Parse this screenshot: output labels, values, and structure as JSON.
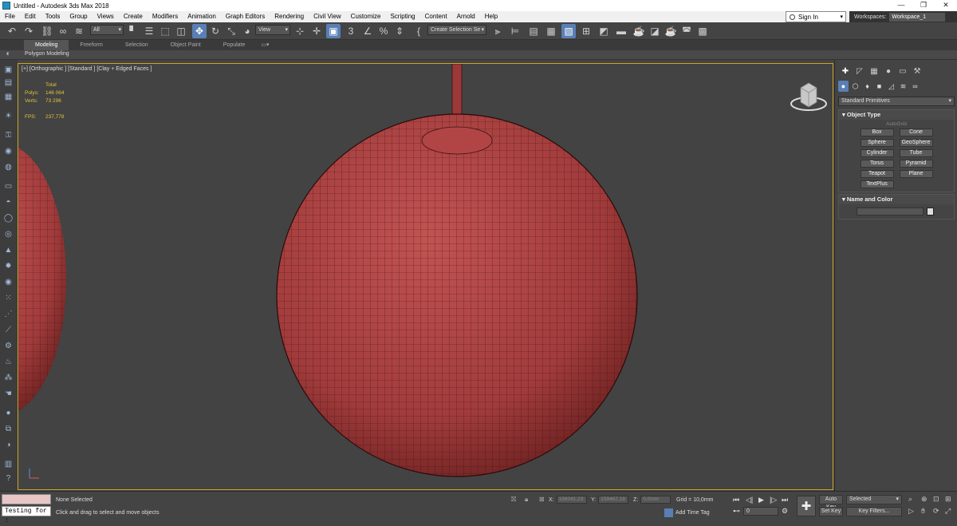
{
  "window": {
    "title": "Untitled - Autodesk 3ds Max 2018",
    "minimize": "—",
    "maximize": "❐",
    "close": "✕"
  },
  "menu": [
    "File",
    "Edit",
    "Tools",
    "Group",
    "Views",
    "Create",
    "Modifiers",
    "Animation",
    "Graph Editors",
    "Rendering",
    "Civil View",
    "Customize",
    "Scripting",
    "Content",
    "Arnold",
    "Help"
  ],
  "account": {
    "sign_in": "Sign In",
    "workspaces_label": "Workspaces:",
    "workspace_value": "Workspace_1"
  },
  "toolbar": {
    "selection_filter": "All",
    "ref_coord": "View",
    "named_selection": "Create Selection Se"
  },
  "ribbon": {
    "tabs": [
      "Modeling",
      "Freeform",
      "Selection",
      "Object Paint",
      "Populate"
    ],
    "active": "Modeling",
    "subpanel": "Polygon Modeling"
  },
  "viewport": {
    "label": "[+] [Orthographic ] [Standard ] [Clay + Edged Faces ]",
    "stats": {
      "total_label": "Total",
      "polys_label": "Polys:",
      "polys": "146 064",
      "verts_label": "Verts:",
      "verts": "73 296",
      "fps_label": "FPS:",
      "fps": "237,778"
    },
    "mesh_color": "#9c3838",
    "border_color": "#c9a628"
  },
  "command_panel": {
    "category": "Standard Primitives",
    "object_type_title": "Object Type",
    "autogrid": "AutoGrid",
    "buttons": [
      "Box",
      "Cone",
      "Sphere",
      "GeoSphere",
      "Cylinder",
      "Tube",
      "Torus",
      "Pyramid",
      "Teapot",
      "Plane",
      "TextPlus"
    ],
    "name_color_title": "Name and Color"
  },
  "status": {
    "listener": "Testing for :",
    "none_selected": "None Selected",
    "prompt": "Click and drag to select and move objects",
    "x_label": "X:",
    "x_value": "156041,23",
    "y_label": "Y:",
    "y_value": "159467,18",
    "z_label": "Z:",
    "z_value": "0,0mm",
    "grid": "Grid = 10,0mm",
    "add_time_tag": "Add Time Tag",
    "frame": "0",
    "auto_key": "Auto Key",
    "set_key": "Set Key",
    "selected": "Selected",
    "key_filters": "Key Filters..."
  }
}
